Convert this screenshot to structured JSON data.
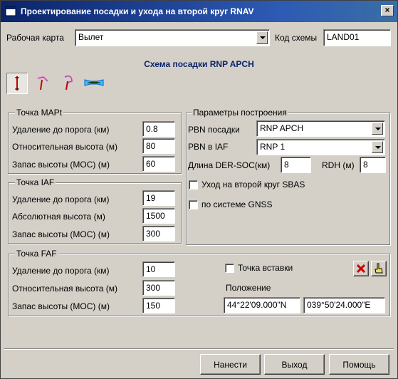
{
  "window": {
    "title": "Проектирование посадки и ухода на второй круг RNAV",
    "close_glyph": "×"
  },
  "top": {
    "work_map_label": "Рабочая карта",
    "work_map_value": "Вылет",
    "scheme_code_label": "Код схемы",
    "scheme_code_value": "LAND01"
  },
  "scheme_title": "Схема посадки RNP APCH",
  "toolbar": {
    "icons": [
      "straight-approach-icon",
      "curved-approach-icon",
      "turn-approach-icon",
      "missed-approach-icon"
    ]
  },
  "mapt": {
    "title": "Точка MAPt",
    "distance_label": "Удаление до порога (км)",
    "distance_value": "0.8",
    "rel_height_label": "Относительная высота (м)",
    "rel_height_value": "80",
    "moc_label": "Запас высоты (МОС) (м)",
    "moc_value": "60"
  },
  "iaf": {
    "title": "Точка IAF",
    "distance_label": "Удаление до порога (км)",
    "distance_value": "19",
    "abs_height_label": "Абсолютная высота (м)",
    "abs_height_value": "1500",
    "moc_label": "Запас высоты (МОС) (м)",
    "moc_value": "300"
  },
  "params": {
    "title": "Параметры построения",
    "pbn_landing_label": "PBN посадки",
    "pbn_landing_value": "RNP APCH",
    "pbn_iaf_label": "PBN в IAF",
    "pbn_iaf_value": "RNP 1",
    "der_soc_label": "Длина DER-SOC(км)",
    "der_soc_value": "8",
    "rdh_label": "RDH (м)",
    "rdh_value": "8",
    "sbas_label": "Уход на второй круг SBAS",
    "sbas_checked": false,
    "gnss_label": "по системе GNSS",
    "gnss_checked": false
  },
  "faf": {
    "title": "Точка FAF",
    "distance_label": "Удаление до порога (км)",
    "distance_value": "10",
    "rel_height_label": "Относительная высота (м)",
    "rel_height_value": "300",
    "moc_label": "Запас высоты (МОС) (м)",
    "moc_value": "150",
    "insert_label": "Точка вставки",
    "insert_checked": false,
    "position_label": "Положение",
    "lat_value": "44°22'09.000\"N",
    "lon_value": "039°50'24.000\"E"
  },
  "buttons": {
    "apply": "Нанести",
    "exit": "Выход",
    "help": "Помощь"
  }
}
